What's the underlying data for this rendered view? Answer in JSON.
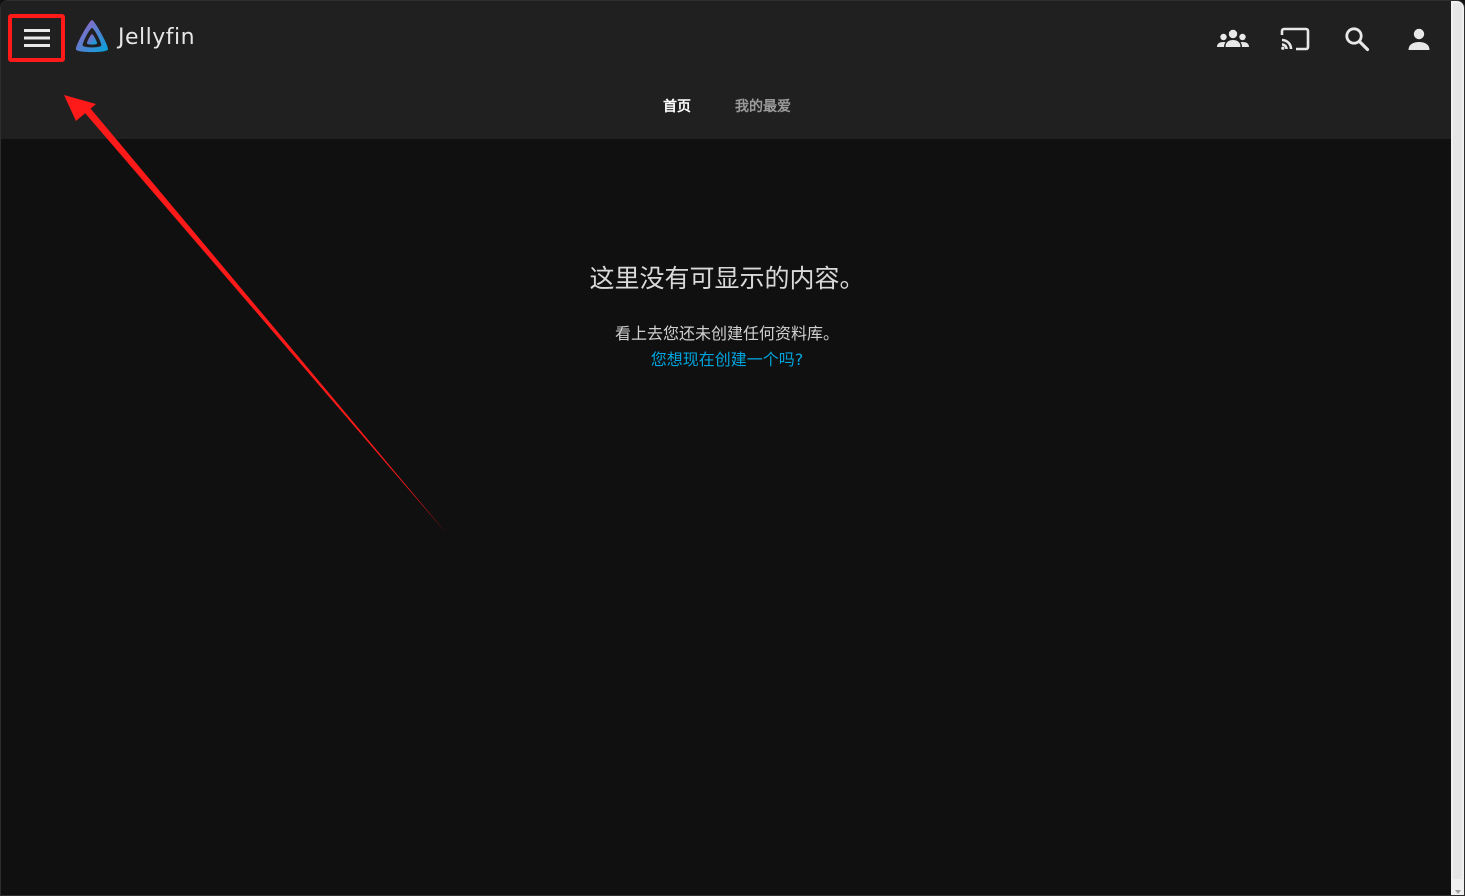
{
  "app": {
    "name": "Jellyfin"
  },
  "header": {
    "menu_icon": "hamburger-menu-icon",
    "icons": [
      "people-icon",
      "cast-icon",
      "search-icon",
      "user-icon"
    ]
  },
  "tabs": [
    {
      "label": "首页",
      "active": true
    },
    {
      "label": "我的最爱",
      "active": false
    }
  ],
  "empty_state": {
    "title": "这里没有可显示的内容。",
    "message": "看上去您还未创建任何资料库。",
    "link_text": "您想现在创建一个吗?"
  },
  "colors": {
    "background": "#101010",
    "header": "#202020",
    "accent_link": "#00a4dc",
    "annotation": "#ff1a1a"
  }
}
